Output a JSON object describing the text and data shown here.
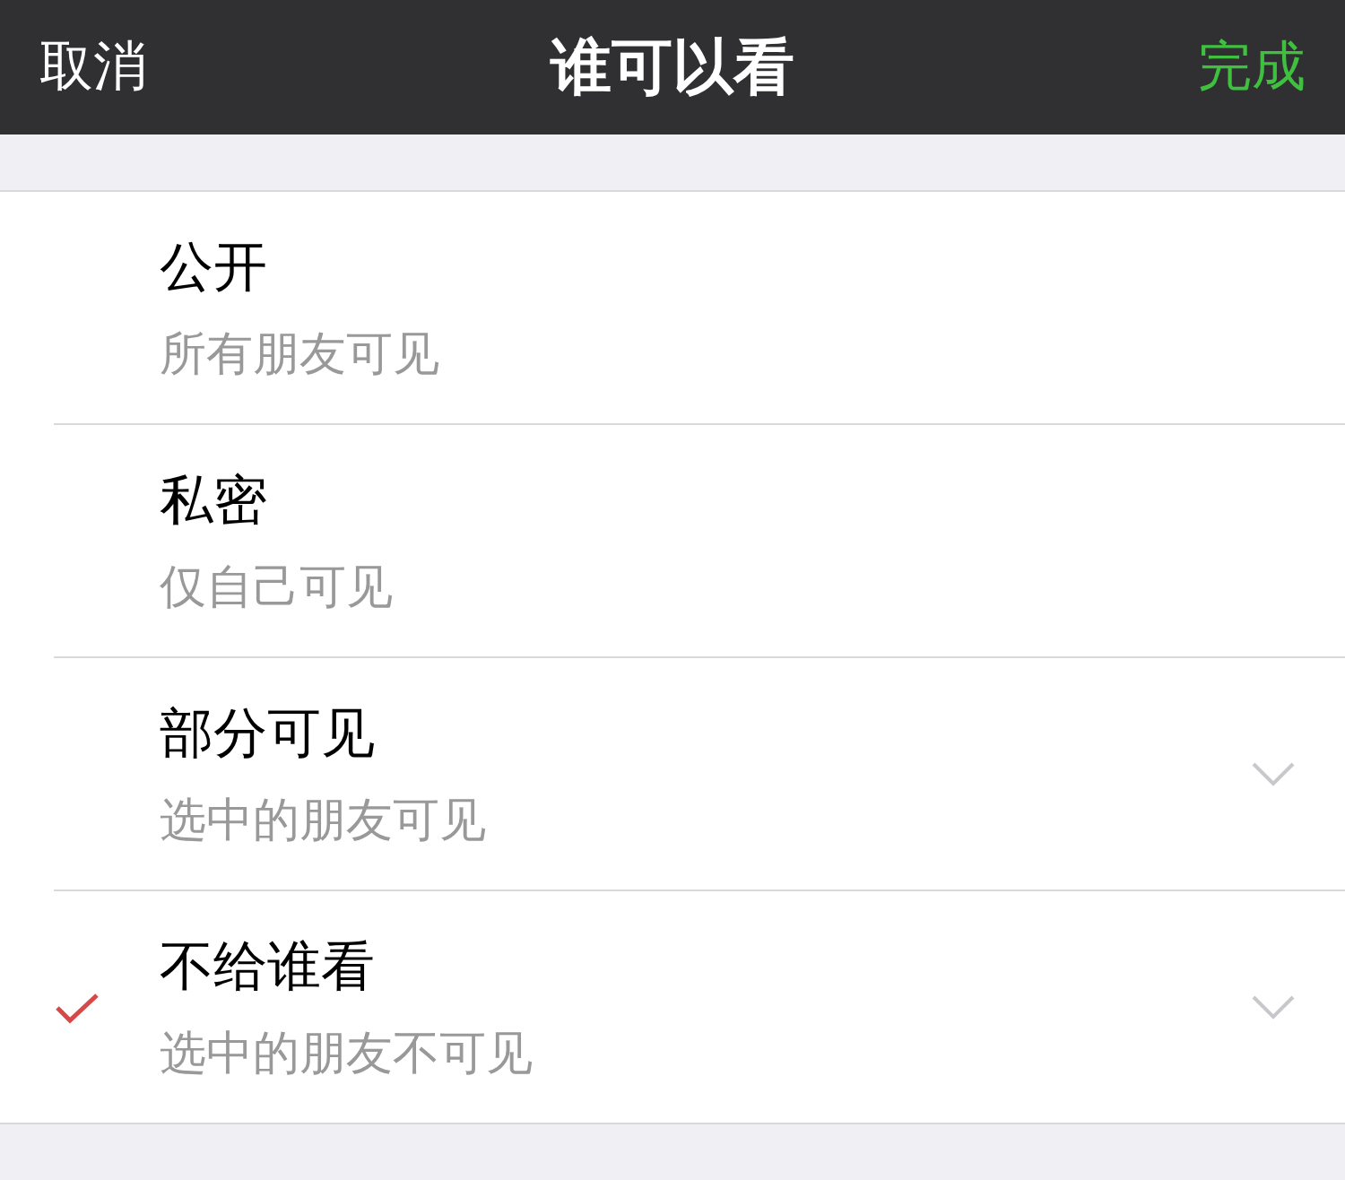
{
  "nav_bar": {
    "cancel": "取消",
    "title": "谁可以看",
    "done": "完成"
  },
  "options": [
    {
      "title": "公开",
      "subtitle": "所有朋友可见",
      "selected": false,
      "expandable": false
    },
    {
      "title": "私密",
      "subtitle": "仅自己可见",
      "selected": false,
      "expandable": false
    },
    {
      "title": "部分可见",
      "subtitle": "选中的朋友可见",
      "selected": false,
      "expandable": true
    },
    {
      "title": "不给谁看",
      "subtitle": "选中的朋友不可见",
      "selected": true,
      "expandable": true
    }
  ]
}
